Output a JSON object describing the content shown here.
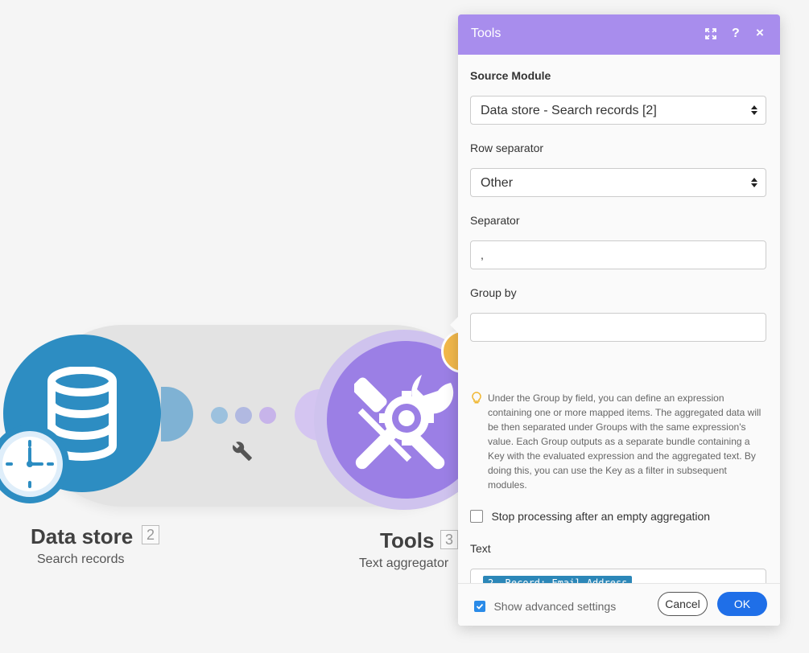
{
  "canvas": {
    "modules": [
      {
        "name": "Data store",
        "number": "2",
        "subtitle": "Search records",
        "icon": "database-icon",
        "color": "#2d8dc2"
      },
      {
        "name": "Tools",
        "number": "3",
        "subtitle": "Text aggregator",
        "icon": "tools-icon",
        "color": "#9b7fe5"
      }
    ],
    "link_icon": "wrench-icon"
  },
  "dialog": {
    "title": "Tools",
    "header_color": "#a88ded",
    "source_module": {
      "label": "Source Module",
      "value": "Data store - Search records [2]"
    },
    "row_separator": {
      "label": "Row separator",
      "value": "Other"
    },
    "separator": {
      "label": "Separator",
      "value": ","
    },
    "group_by": {
      "label": "Group by",
      "value": "",
      "help": "Under the Group by field, you can define an expression containing one or more mapped items. The aggregated data will be then separated under Groups with the same expression's value. Each Group outputs as a separate bundle containing a Key with the evaluated expression and the aggregated text. By doing this, you can use the Key as a filter in subsequent modules."
    },
    "stop_processing": {
      "label": "Stop processing after an empty aggregation",
      "checked": false
    },
    "text": {
      "label": "Text",
      "pill": "2. Record: Email Address"
    },
    "footer": {
      "advanced_label": "Show advanced settings",
      "advanced_checked": true,
      "cancel_label": "Cancel",
      "ok_label": "OK",
      "ok_color": "#1f6fe8"
    }
  }
}
